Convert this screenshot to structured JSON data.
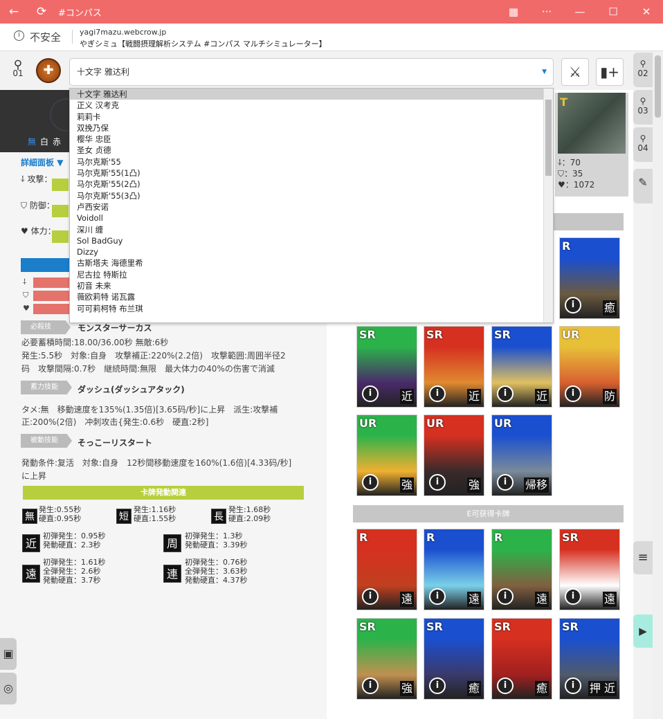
{
  "titlebar": {
    "title": "#コンパス"
  },
  "address": {
    "security": "不安全",
    "url": "yagi7mazu.webcrow.jp",
    "page_title": "やぎシミュ【戦闘摂理解析システム #コンパス マルチシミュレーター】"
  },
  "player": {
    "number": "01"
  },
  "select": {
    "value": "十文字 雅达利"
  },
  "rail": {
    "t2": "02",
    "t3": "03",
    "t4": "04"
  },
  "left": {
    "chars": [
      "無",
      "白",
      "赤"
    ],
    "detail": "詳細面板",
    "atk": "攻撃：",
    "def": "防御：",
    "hp": "体力：",
    "sk_label": "必殺技",
    "sk_name": "モンスターサーカス",
    "sk_t1": "必要蓄積時間:18.00/36.00秒 無敵:6秒",
    "sk_t2": "発生:5.5秒　対象:自身　攻撃補正:220%(2.2倍)　攻撃範囲:周囲半径2",
    "sk_t3": "码　攻撃間隔:0.7秒　継続時間:無限　最大体力の40%の伤害で消滅",
    "hold_label": "蓄力技能",
    "hold_name": "ダッシュ(ダッシュアタック)",
    "hold_t1": "タメ:無　移動速度を135%(1.35倍)[3.65码/秒]に上昇　派生:攻撃補",
    "hold_t2": "正:200%(2倍)　冲刺攻击{発生:0.6秒　硬直:2秒]",
    "pas_label": "被動技能",
    "pas_name": "そっこーリスタート",
    "pas_t1": "発動条件:复活　対象:自身　12秒間移動速度を160%(1.6倍)[4.33码/秒]",
    "pas_t2": "に上昇",
    "green": "卡牌発動関連",
    "k1": "無",
    "k1a": "発生:0.55秒",
    "k1b": "硬直:0.95秒",
    "k2": "短",
    "k2a": "発生:1.16秒",
    "k2b": "硬直:1.55秒",
    "k3": "長",
    "k3a": "発生:1.68秒",
    "k3b": "硬直:2.09秒",
    "k4": "近",
    "k4a": "初弾発生：0.95秒",
    "k4b": "発動硬直：2.3秒",
    "k5": "周",
    "k5a": "初弾発生：1.3秒",
    "k5b": "発動硬直：3.39秒",
    "k6": "遠",
    "k6a": "初弾発生：1.61秒",
    "k6b": "全弾発生：2.6秒",
    "k6c": "発動硬直：3.7秒",
    "k7": "連",
    "k7a": "初弾発生：0.76秒",
    "k7b": "全弾発生：3.63秒",
    "k7c": "発動硬直：4.37秒"
  },
  "toppic": {
    "atk": "：70",
    "def": "：35",
    "hp": "：1072"
  },
  "sections": {
    "e": "E可获得卡牌"
  },
  "cards": [
    {
      "r": "R",
      "t": "癒",
      "c1": "#1a4fd0",
      "c2": "#6a5a40"
    },
    {
      "r": "SR",
      "t": "近",
      "c1": "#2bb34a",
      "c2": "#4a2a6a"
    },
    {
      "r": "SR",
      "t": "近",
      "c1": "#d63020",
      "c2": "#e08a30"
    },
    {
      "r": "SR",
      "t": "近",
      "c1": "#1a4fd0",
      "c2": "#e0c060"
    },
    {
      "r": "UR",
      "t": "防",
      "c1": "#e8c038",
      "c2": "#d86030"
    },
    {
      "r": "UR",
      "t": "強",
      "c1": "#2bb34a",
      "c2": "#f0b030"
    },
    {
      "r": "UR",
      "t": "強",
      "c1": "#d63020",
      "c2": "#3a2a2a"
    },
    {
      "r": "UR",
      "t": "帰移",
      "c1": "#1a4fd0",
      "c2": "#7a8a9a"
    },
    {
      "r": "R",
      "t": "遠",
      "c1": "#d63020",
      "c2": "#c04020"
    },
    {
      "r": "R",
      "t": "遠",
      "c1": "#1a4fd0",
      "c2": "#7ad0e8"
    },
    {
      "r": "R",
      "t": "遠",
      "c1": "#2bb34a",
      "c2": "#806040"
    },
    {
      "r": "SR",
      "t": "遠",
      "c1": "#d63020",
      "c2": "#ffffff"
    },
    {
      "r": "SR",
      "t": "強",
      "c1": "#2bb34a",
      "c2": "#c09050"
    },
    {
      "r": "SR",
      "t": "癒",
      "c1": "#1a4fd0",
      "c2": "#3a3a6a"
    },
    {
      "r": "SR",
      "t": "癒",
      "c1": "#d63020",
      "c2": "#a02020"
    },
    {
      "r": "SR",
      "t": "押 近",
      "c1": "#1a4fd0",
      "c2": "#505a6a"
    }
  ],
  "dropdown": [
    "十文字 雅达利",
    "正义 汉考克",
    "莉莉卡",
    "双挽乃保",
    "樱华 忠臣",
    "圣女 贞德",
    "马尔克斯'55",
    "马尔克斯'55(1凸)",
    "马尔克斯'55(2凸)",
    "马尔克斯'55(3凸)",
    "卢西安诺",
    "Voidoll",
    "深川 缠",
    "Sol BadGuy",
    "Dizzy",
    "古斯塔夫 海德里希",
    "尼古拉 特斯拉",
    "初音 未来",
    "薇欧莉特 诺瓦露",
    "可可莉柯特 布兰琪"
  ]
}
